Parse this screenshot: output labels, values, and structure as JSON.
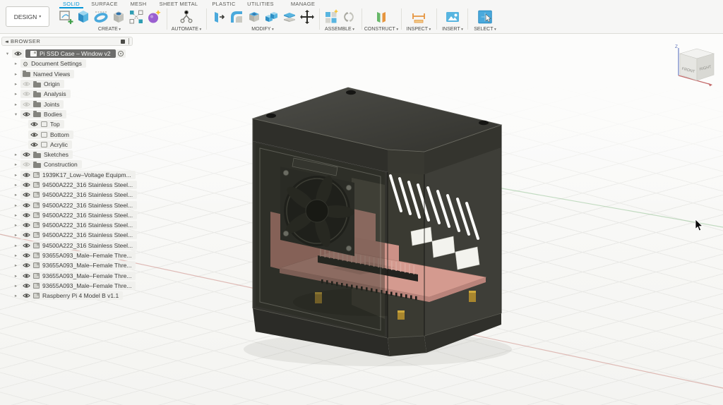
{
  "toolbar": {
    "design_button": "DESIGN",
    "tabs": [
      {
        "label": "SOLID",
        "active": true
      },
      {
        "label": "SURFACE",
        "active": false
      },
      {
        "label": "MESH",
        "active": false
      },
      {
        "label": "SHEET METAL",
        "active": false
      },
      {
        "label": "PLASTIC",
        "active": false
      },
      {
        "label": "UTILITIES",
        "active": false
      },
      {
        "label": "MANAGE",
        "active": false
      }
    ],
    "groups": [
      {
        "label": "CREATE",
        "icons": [
          "create-sketch",
          "extrude",
          "revolve",
          "hole",
          "pattern",
          "form"
        ]
      },
      {
        "label": "AUTOMATE",
        "icons": [
          "automate"
        ]
      },
      {
        "label": "MODIFY",
        "icons": [
          "press-pull",
          "fillet",
          "shell",
          "combine",
          "split",
          "move"
        ]
      },
      {
        "label": "ASSEMBLE",
        "icons": [
          "new-component",
          "joint"
        ]
      },
      {
        "label": "CONSTRUCT",
        "icons": [
          "construction-plane"
        ]
      },
      {
        "label": "INSPECT",
        "icons": [
          "measure"
        ]
      },
      {
        "label": "INSERT",
        "icons": [
          "insert-canvas"
        ]
      },
      {
        "label": "SELECT",
        "icons": [
          "select-window"
        ]
      }
    ]
  },
  "browser": {
    "title": "BROWSER",
    "root": {
      "label": "Pi SSD Case – Window v2",
      "eye": "on"
    },
    "items": [
      {
        "label": "Document Settings",
        "expand": "closed",
        "eye": "none",
        "icon": "gear",
        "indent": 1
      },
      {
        "label": "Named Views",
        "expand": "closed",
        "eye": "none",
        "icon": "folder",
        "indent": 1
      },
      {
        "label": "Origin",
        "expand": "closed",
        "eye": "off",
        "icon": "folder",
        "indent": 1
      },
      {
        "label": "Analysis",
        "expand": "closed",
        "eye": "off",
        "icon": "folder",
        "indent": 1
      },
      {
        "label": "Joints",
        "expand": "closed",
        "eye": "off",
        "icon": "folder",
        "indent": 1
      },
      {
        "label": "Bodies",
        "expand": "open",
        "eye": "on",
        "icon": "folder",
        "indent": 1
      },
      {
        "label": "Top",
        "expand": "none",
        "eye": "on",
        "icon": "body",
        "indent": 2
      },
      {
        "label": "Bottom",
        "expand": "none",
        "eye": "on",
        "icon": "body",
        "indent": 2
      },
      {
        "label": "Acrylic",
        "expand": "none",
        "eye": "on",
        "icon": "body",
        "indent": 2
      },
      {
        "label": "Sketches",
        "expand": "closed",
        "eye": "on",
        "icon": "folder",
        "indent": 1
      },
      {
        "label": "Construction",
        "expand": "closed",
        "eye": "off",
        "icon": "folder",
        "indent": 1
      },
      {
        "label": "1939K17_Low–Voltage Equipm...",
        "expand": "closed",
        "eye": "on",
        "icon": "comp",
        "indent": 1
      },
      {
        "label": "94500A222_316 Stainless Steel...",
        "expand": "closed",
        "eye": "on",
        "icon": "comp",
        "indent": 1
      },
      {
        "label": "94500A222_316 Stainless Steel...",
        "expand": "closed",
        "eye": "on",
        "icon": "comp",
        "indent": 1
      },
      {
        "label": "94500A222_316 Stainless Steel...",
        "expand": "closed",
        "eye": "on",
        "icon": "comp",
        "indent": 1
      },
      {
        "label": "94500A222_316 Stainless Steel...",
        "expand": "closed",
        "eye": "on",
        "icon": "comp",
        "indent": 1
      },
      {
        "label": "94500A222_316 Stainless Steel...",
        "expand": "closed",
        "eye": "on",
        "icon": "comp",
        "indent": 1
      },
      {
        "label": "94500A222_316 Stainless Steel...",
        "expand": "closed",
        "eye": "on",
        "icon": "comp",
        "indent": 1
      },
      {
        "label": "94500A222_316 Stainless Steel...",
        "expand": "closed",
        "eye": "on",
        "icon": "comp",
        "indent": 1
      },
      {
        "label": "93655A093_Male–Female Thre...",
        "expand": "closed",
        "eye": "on",
        "icon": "comp",
        "indent": 1
      },
      {
        "label": "93655A093_Male–Female Thre...",
        "expand": "closed",
        "eye": "on",
        "icon": "comp",
        "indent": 1
      },
      {
        "label": "93655A093_Male–Female Thre...",
        "expand": "closed",
        "eye": "on",
        "icon": "comp",
        "indent": 1
      },
      {
        "label": "93655A093_Male–Female Thre...",
        "expand": "closed",
        "eye": "on",
        "icon": "comp",
        "indent": 1
      },
      {
        "label": "Raspberry Pi 4 Model B v1.1",
        "expand": "closed",
        "eye": "on",
        "icon": "comp",
        "indent": 1
      }
    ]
  },
  "viewport": {
    "viewcube": {
      "front_label": "FRONT",
      "right_label": "RIGHT",
      "z_axis_label": "Z"
    }
  },
  "colors": {
    "accent_blue": "#0696d7",
    "case_body": "#3a3a34",
    "acrylic_tint": "#2e3029",
    "pi_board_salmon": "#d49a8f",
    "brass_standoff": "#a8862e",
    "vent_slot": "#fbfbf9",
    "axis_x_red": "#cc8a84",
    "axis_y_green": "#96c296",
    "axis_z_blue": "#5a74b8"
  }
}
